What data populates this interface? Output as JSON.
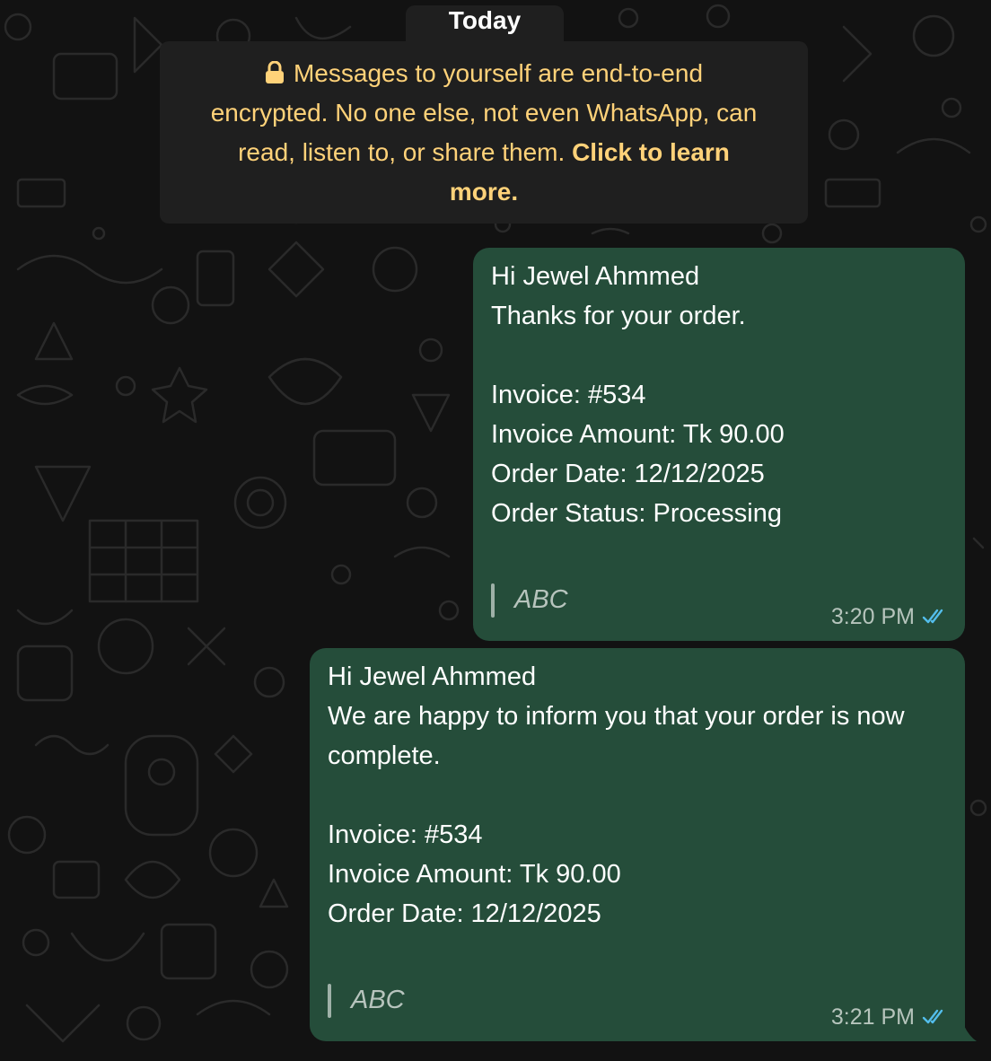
{
  "date_chip": "Today",
  "encryption_notice": {
    "lead": "Messages to yourself are end-to-end",
    "line2": "encrypted. No one else, not even WhatsApp, can",
    "line3_plain": "read, listen to, or share them.",
    "link_part1": "Click to learn",
    "link_part2": "more."
  },
  "messages": [
    {
      "lines": [
        "Hi Jewel Ahmmed",
        "Thanks for your order.",
        "",
        "Invoice: #534",
        "Invoice Amount: Tk 90.00",
        "Order Date: 12/12/2025",
        "Order Status: Processing"
      ],
      "footer": "ABC",
      "time": "3:20 PM",
      "status": "read"
    },
    {
      "lines": [
        "Hi Jewel Ahmmed",
        "We are happy to inform you that your order is now",
        "complete.",
        "",
        "Invoice: #534",
        "Invoice Amount: Tk 90.00",
        "Order Date: 12/12/2025"
      ],
      "footer": "ABC",
      "time": "3:21 PM",
      "status": "read"
    }
  ],
  "colors": {
    "bubble_outgoing": "#254d3a",
    "notice_text": "#ffd279",
    "read_ticks": "#53bdeb",
    "background": "#121212"
  },
  "icons": [
    "lock-icon",
    "double-check-icon"
  ]
}
